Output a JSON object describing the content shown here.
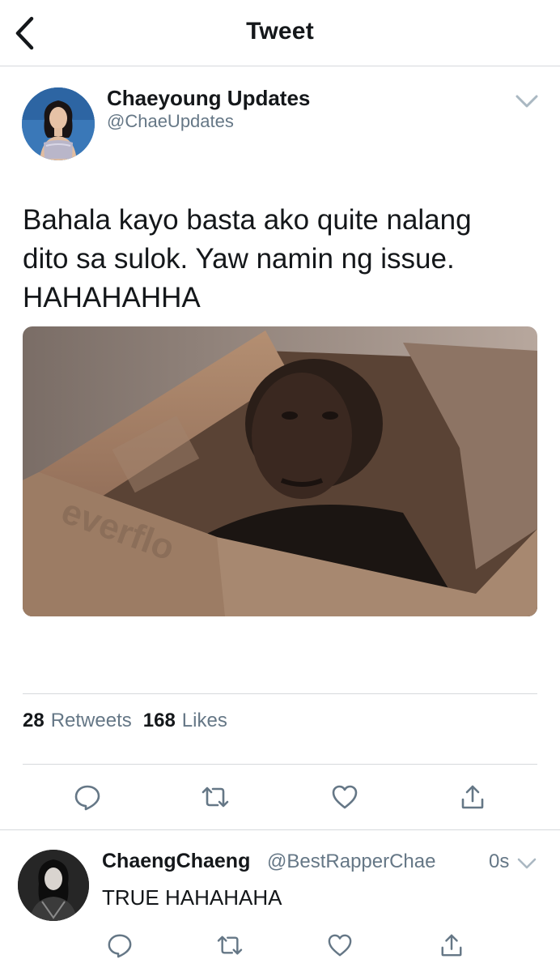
{
  "nav": {
    "title": "Tweet"
  },
  "tweet": {
    "display_name": "Chaeyoung Updates",
    "handle": "@ChaeUpdates",
    "text": "Bahala kayo basta ako quite nalang\ndito sa sulok. Yaw namin ng issue.\nHAHAHAHHA",
    "stats": {
      "retweets_count": "28",
      "retweets_label": "Retweets",
      "likes_count": "168",
      "likes_label": "Likes"
    },
    "actions": [
      "reply-icon",
      "retweet-icon",
      "like-icon",
      "share-icon"
    ]
  },
  "reply": {
    "display_name": "ChaengChaeng",
    "handle": "@BestRapperChae",
    "time": "0s",
    "text": "TRUE HAHAHAHA",
    "actions": [
      "reply-icon",
      "retweet-icon",
      "like-icon",
      "share-icon"
    ]
  },
  "colors": {
    "text_primary": "#14171a",
    "text_secondary": "#657786",
    "icon": "#657786",
    "divider": "#d6d9dc"
  }
}
